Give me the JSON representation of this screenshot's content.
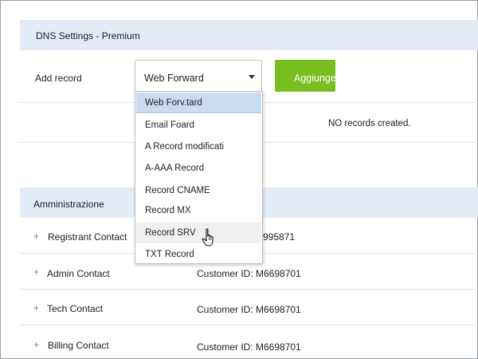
{
  "dns": {
    "title": "DNS Settings - Premium",
    "add_record_label": "Add record",
    "selected_type": "Web Forward",
    "add_button_label": "Aggiunge",
    "no_records": "NO records created.",
    "options": [
      "Web Forv.tard",
      "Email Foard",
      "A Record modificati",
      "A-AAA Record",
      "Record CNAME",
      "Record MX",
      "Record SRV",
      "TXT Record"
    ],
    "selected_index": 0,
    "hovered_index": 6
  },
  "admin": {
    "title": "Amministrazione",
    "contacts": [
      {
        "label": "Registrant Contact",
        "id_text": "995871"
      },
      {
        "label": "Admin Contact",
        "id_text": "Customer ID: M6698701"
      },
      {
        "label": "Tech Contact",
        "id_text": "Customer ID: M6698701"
      },
      {
        "label": "Billing Contact",
        "id_text": "Customer ID: M6698701"
      }
    ]
  },
  "colors": {
    "header_band": "#e3ecf6",
    "accent_green": "#79bd1e",
    "selected_option": "#c9dcf1",
    "plus_blue": "#4a86c5"
  },
  "icons": {
    "dropdown_caret": "chevron-down-icon",
    "expand": "plus-icon",
    "cursor": "hand-pointer-icon"
  }
}
